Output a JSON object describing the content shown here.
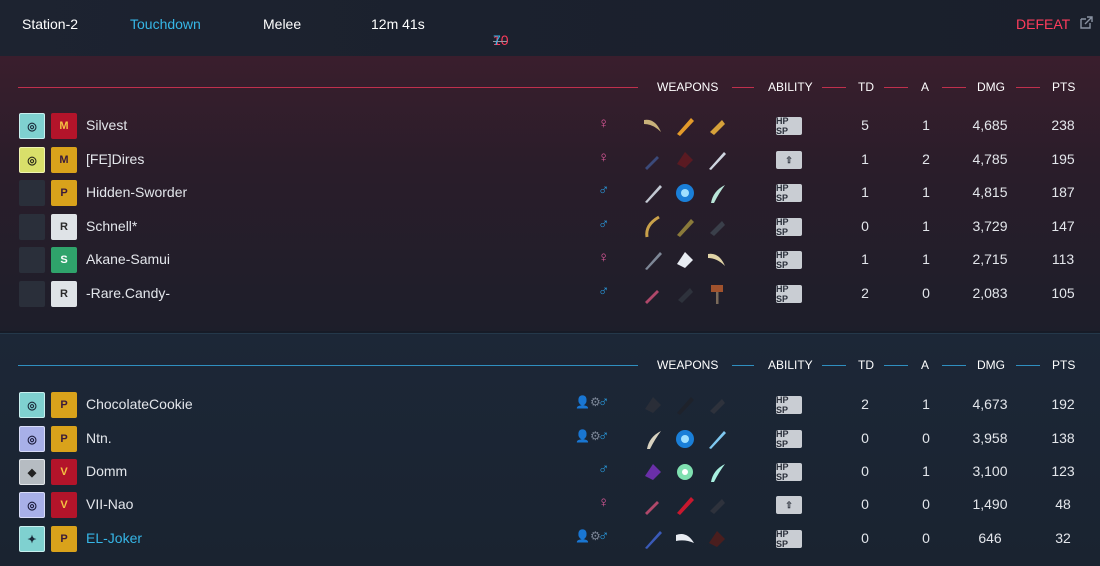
{
  "match": {
    "map": "Station-2",
    "mode": "Touchdown",
    "type": "Melee",
    "duration": "12m 41s",
    "score_red": "10",
    "score_sep": "—",
    "score_blue": "7",
    "result": "DEFEAT"
  },
  "headers": {
    "weapons": "WEAPONS",
    "ability": "ABILITY",
    "td": "TD",
    "a": "A",
    "dmg": "DMG",
    "pts": "PTS"
  },
  "ability_labels": {
    "standard": "HP SP",
    "lift": "⇧"
  },
  "colors": {
    "red_team": "#ff3c5c",
    "blue_team": "#36b6e6",
    "female": "#e05a9c",
    "male": "#2aa0e6"
  },
  "red_team": [
    {
      "name": "Silvest",
      "gender": "♀",
      "td": "5",
      "a": "1",
      "dmg": "4,685",
      "pts": "238"
    },
    {
      "name": "[FE]Dires",
      "gender": "♀",
      "td": "1",
      "a": "2",
      "dmg": "4,785",
      "pts": "195"
    },
    {
      "name": "Hidden-Sworder",
      "gender": "♂",
      "td": "1",
      "a": "1",
      "dmg": "4,815",
      "pts": "187"
    },
    {
      "name": "Schnell*",
      "gender": "♂",
      "td": "0",
      "a": "1",
      "dmg": "3,729",
      "pts": "147"
    },
    {
      "name": "Akane-Samui",
      "gender": "♀",
      "td": "1",
      "a": "1",
      "dmg": "2,715",
      "pts": "113"
    },
    {
      "name": "-Rare.Candy-",
      "gender": "♂",
      "td": "2",
      "a": "0",
      "dmg": "2,083",
      "pts": "105"
    }
  ],
  "blue_team": [
    {
      "name": "ChocolateCookie",
      "gender": "♂",
      "td": "2",
      "a": "1",
      "dmg": "4,673",
      "pts": "192"
    },
    {
      "name": "Ntn.",
      "gender": "♂",
      "td": "0",
      "a": "0",
      "dmg": "3,958",
      "pts": "138"
    },
    {
      "name": "Domm",
      "gender": "♂",
      "td": "0",
      "a": "1",
      "dmg": "3,100",
      "pts": "123"
    },
    {
      "name": "VII-Nao",
      "gender": "♀",
      "td": "0",
      "a": "0",
      "dmg": "1,490",
      "pts": "48"
    },
    {
      "name": "EL-Joker",
      "gender": "♂",
      "td": "0",
      "a": "0",
      "dmg": "646",
      "pts": "32"
    }
  ]
}
